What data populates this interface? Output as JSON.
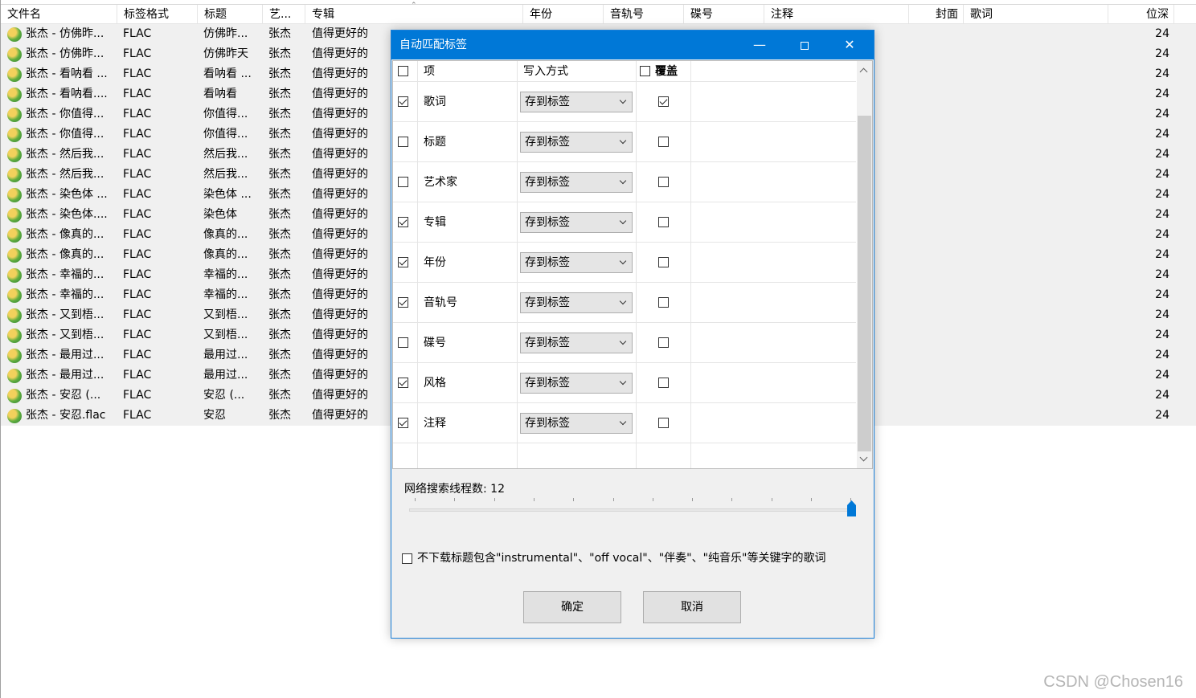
{
  "file_list": {
    "columns": [
      "文件名",
      "标签格式",
      "标题",
      "艺...",
      "专辑",
      "年份",
      "音轨号",
      "碟号",
      "注释",
      "封面",
      "歌词",
      "位深"
    ],
    "rows": [
      {
        "file": "张杰 - 仿佛昨...",
        "format": "FLAC",
        "title": "仿佛昨...",
        "artist": "张杰",
        "album": "值得更好的",
        "bitdepth": "24"
      },
      {
        "file": "张杰 - 仿佛昨...",
        "format": "FLAC",
        "title": "仿佛昨天",
        "artist": "张杰",
        "album": "值得更好的",
        "bitdepth": "24"
      },
      {
        "file": "张杰 - 看呐看 ...",
        "format": "FLAC",
        "title": "看呐看 ...",
        "artist": "张杰",
        "album": "值得更好的",
        "bitdepth": "24"
      },
      {
        "file": "张杰 - 看呐看....",
        "format": "FLAC",
        "title": "看呐看",
        "artist": "张杰",
        "album": "值得更好的",
        "bitdepth": "24"
      },
      {
        "file": "张杰 - 你值得...",
        "format": "FLAC",
        "title": "你值得...",
        "artist": "张杰",
        "album": "值得更好的",
        "bitdepth": "24"
      },
      {
        "file": "张杰 - 你值得...",
        "format": "FLAC",
        "title": "你值得...",
        "artist": "张杰",
        "album": "值得更好的",
        "bitdepth": "24"
      },
      {
        "file": "张杰 - 然后我...",
        "format": "FLAC",
        "title": "然后我...",
        "artist": "张杰",
        "album": "值得更好的",
        "bitdepth": "24"
      },
      {
        "file": "张杰 - 然后我...",
        "format": "FLAC",
        "title": "然后我...",
        "artist": "张杰",
        "album": "值得更好的",
        "bitdepth": "24"
      },
      {
        "file": "张杰 - 染色体 ...",
        "format": "FLAC",
        "title": "染色体 ...",
        "artist": "张杰",
        "album": "值得更好的",
        "bitdepth": "24"
      },
      {
        "file": "张杰 - 染色体....",
        "format": "FLAC",
        "title": "染色体",
        "artist": "张杰",
        "album": "值得更好的",
        "bitdepth": "24"
      },
      {
        "file": "张杰 - 像真的...",
        "format": "FLAC",
        "title": "像真的...",
        "artist": "张杰",
        "album": "值得更好的",
        "bitdepth": "24"
      },
      {
        "file": "张杰 - 像真的...",
        "format": "FLAC",
        "title": "像真的...",
        "artist": "张杰",
        "album": "值得更好的",
        "bitdepth": "24"
      },
      {
        "file": "张杰 - 幸福的...",
        "format": "FLAC",
        "title": "幸福的...",
        "artist": "张杰",
        "album": "值得更好的",
        "bitdepth": "24"
      },
      {
        "file": "张杰 - 幸福的...",
        "format": "FLAC",
        "title": "幸福的...",
        "artist": "张杰",
        "album": "值得更好的",
        "bitdepth": "24"
      },
      {
        "file": "张杰 - 又到梧...",
        "format": "FLAC",
        "title": "又到梧...",
        "artist": "张杰",
        "album": "值得更好的",
        "bitdepth": "24"
      },
      {
        "file": "张杰 - 又到梧...",
        "format": "FLAC",
        "title": "又到梧...",
        "artist": "张杰",
        "album": "值得更好的",
        "bitdepth": "24"
      },
      {
        "file": "张杰 - 最用过...",
        "format": "FLAC",
        "title": "最用过...",
        "artist": "张杰",
        "album": "值得更好的",
        "bitdepth": "24"
      },
      {
        "file": "张杰 - 最用过...",
        "format": "FLAC",
        "title": "最用过...",
        "artist": "张杰",
        "album": "值得更好的",
        "bitdepth": "24"
      },
      {
        "file": "张杰 - 安忍 (...",
        "format": "FLAC",
        "title": "安忍 (...",
        "artist": "张杰",
        "album": "值得更好的",
        "bitdepth": "24"
      },
      {
        "file": "张杰 - 安忍.flac",
        "format": "FLAC",
        "title": "安忍",
        "artist": "张杰",
        "album": "值得更好的",
        "bitdepth": "24"
      }
    ]
  },
  "dialog": {
    "title": "自动匹配标签",
    "minimize_glyph": "—",
    "close_glyph": "✕",
    "grid_header": {
      "item": "项",
      "write_mode": "写入方式",
      "overwrite": "覆盖"
    },
    "rows": [
      {
        "label": "歌词",
        "checked": true,
        "mode": "存到标签",
        "overwrite": true
      },
      {
        "label": "标题",
        "checked": false,
        "mode": "存到标签",
        "overwrite": false
      },
      {
        "label": "艺术家",
        "checked": false,
        "mode": "存到标签",
        "overwrite": false
      },
      {
        "label": "专辑",
        "checked": true,
        "mode": "存到标签",
        "overwrite": false
      },
      {
        "label": "年份",
        "checked": true,
        "mode": "存到标签",
        "overwrite": false
      },
      {
        "label": "音轨号",
        "checked": true,
        "mode": "存到标签",
        "overwrite": false
      },
      {
        "label": "碟号",
        "checked": false,
        "mode": "存到标签",
        "overwrite": false
      },
      {
        "label": "风格",
        "checked": true,
        "mode": "存到标签",
        "overwrite": false
      },
      {
        "label": "注释",
        "checked": true,
        "mode": "存到标签",
        "overwrite": false
      }
    ],
    "thread_label": "网络搜索线程数: 12",
    "thread_value": 12,
    "skip_option_label": "不下载标题包含\"instrumental\"、\"off vocal\"、\"伴奏\"、\"纯音乐\"等关键字的歌词",
    "skip_option_checked": false,
    "ok_label": "确定",
    "cancel_label": "取消"
  },
  "watermark": "CSDN @Chosen16"
}
